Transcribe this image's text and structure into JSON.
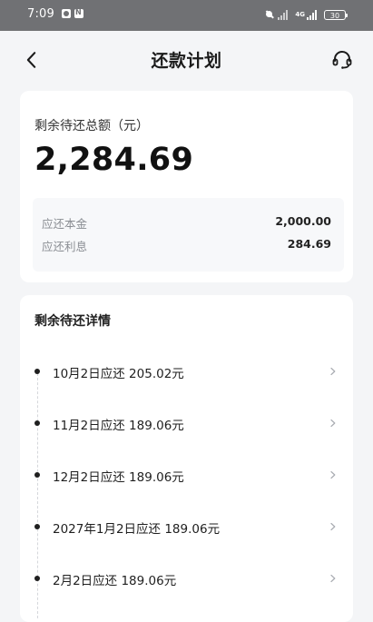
{
  "status_bar": {
    "time": "7:09",
    "network_label": "4G",
    "battery": "30",
    "icons": [
      "mute-icon",
      "signal-icon",
      "battery-icon"
    ]
  },
  "nav": {
    "title": "还款计划",
    "back_icon": "chevron-left-icon",
    "service_icon": "headset-icon"
  },
  "summary": {
    "remaining_label": "剩余待还总额（元）",
    "remaining_amount": "2,284.69",
    "principal_label": "应还本金",
    "principal_value": "2,000.00",
    "interest_label": "应还利息",
    "interest_value": "284.69"
  },
  "details": {
    "title": "剩余待还详情",
    "items": [
      {
        "text": "10月2日应还 205.02元"
      },
      {
        "text": "11月2日应还 189.06元"
      },
      {
        "text": "12月2日应还 189.06元"
      },
      {
        "text": "2027年1月2日应还 189.06元"
      },
      {
        "text": "2月2日应还 189.06元"
      }
    ]
  },
  "colors": {
    "status_bar_bg": "#707174",
    "page_bg": "#f4f5f7",
    "card_bg": "#ffffff",
    "secondary_text": "#8a8d93"
  }
}
